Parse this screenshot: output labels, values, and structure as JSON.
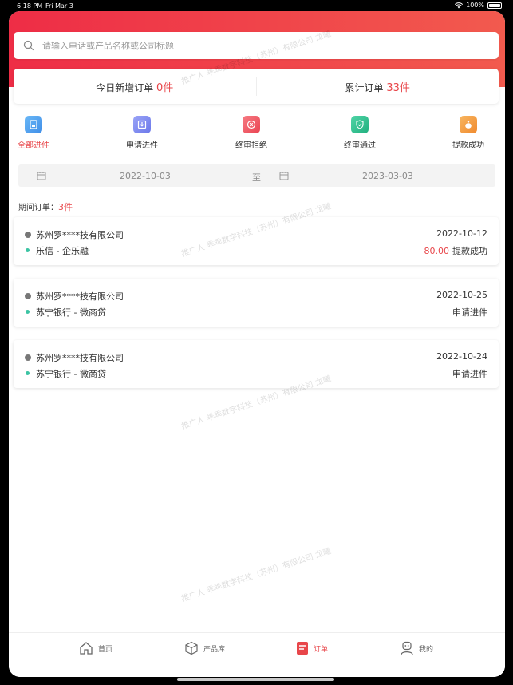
{
  "status_bar": {
    "time": "6:18 PM",
    "date": "Fri Mar 3",
    "battery": "100%"
  },
  "search": {
    "placeholder": "请输入电话或产品名称或公司标题"
  },
  "stats": {
    "today_label": "今日新增订单",
    "today_value": "0件",
    "total_label": "累计订单",
    "total_value": "33件"
  },
  "filters": [
    {
      "label": "全部进件",
      "icon": "document-lock-icon",
      "color": "#4f9ff0"
    },
    {
      "label": "申请进件",
      "icon": "inbox-download-icon",
      "color": "#7a86f0"
    },
    {
      "label": "终审拒绝",
      "icon": "close-circle-icon",
      "color": "#f0555e"
    },
    {
      "label": "终审通过",
      "icon": "shield-check-icon",
      "color": "#2fbf8f"
    },
    {
      "label": "提款成功",
      "icon": "money-bag-icon",
      "color": "#f59a3d"
    }
  ],
  "date_range": {
    "start": "2022-10-03",
    "separator": "至",
    "end": "2023-03-03"
  },
  "period": {
    "label": "期间订单：",
    "count": "3件"
  },
  "orders": [
    {
      "company": "苏州罗****技有限公司",
      "date": "2022-10-12",
      "product": "乐信 - 企乐融",
      "amount": "80.00",
      "status": "提款成功"
    },
    {
      "company": "苏州罗****技有限公司",
      "date": "2022-10-25",
      "product": "苏宁银行 - 微商贷",
      "amount": "",
      "status": "申请进件"
    },
    {
      "company": "苏州罗****技有限公司",
      "date": "2022-10-24",
      "product": "苏宁银行 - 微商贷",
      "amount": "",
      "status": "申请进件"
    }
  ],
  "watermark": "推广人  乖乖数字科技（苏州）有限公司  龙曦",
  "tabs": [
    {
      "label": "首页",
      "icon": "home-icon"
    },
    {
      "label": "产品库",
      "icon": "cube-icon"
    },
    {
      "label": "订单",
      "icon": "order-icon"
    },
    {
      "label": "我的",
      "icon": "user-icon"
    }
  ],
  "colors": {
    "accent": "#e8464a",
    "header_start": "#ee2d46",
    "header_end": "#f25a4e"
  }
}
